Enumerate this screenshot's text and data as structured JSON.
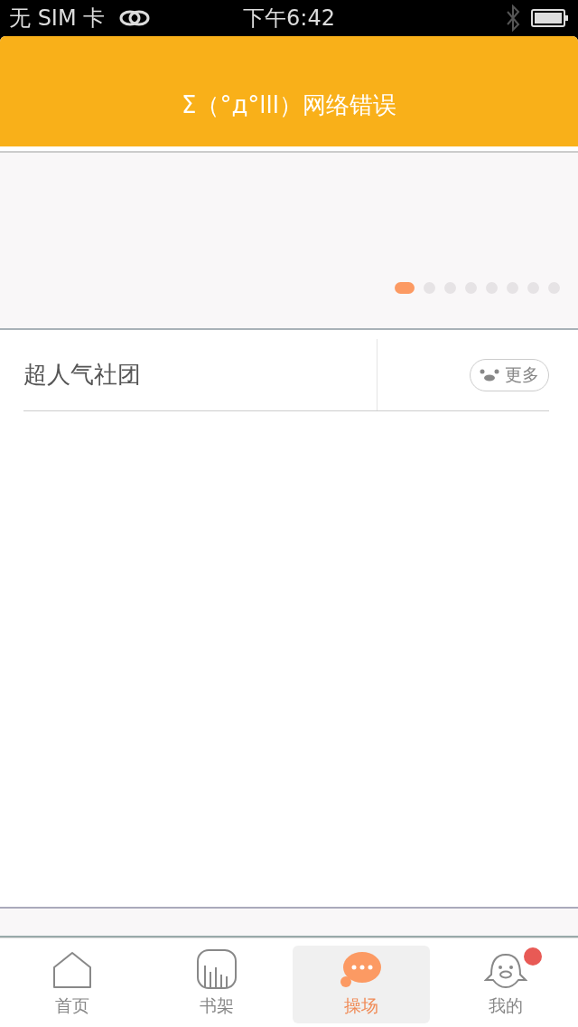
{
  "status_bar": {
    "carrier": "无 SIM 卡",
    "time": "下午6:42"
  },
  "header": {
    "message": "Σ（°д°lll）网络错误"
  },
  "banner": {
    "dots": [
      {
        "selected": true
      },
      {
        "selected": false
      },
      {
        "selected": false
      },
      {
        "selected": false
      },
      {
        "selected": false
      },
      {
        "selected": false
      },
      {
        "selected": false
      },
      {
        "selected": false
      }
    ]
  },
  "section": {
    "title": "超人气社团",
    "more": "更多"
  },
  "tabs": [
    {
      "kind": "home",
      "label": "首页",
      "selected": false,
      "badge": false
    },
    {
      "kind": "shelf",
      "label": "书架",
      "selected": false,
      "badge": false
    },
    {
      "kind": "chat",
      "label": "操场",
      "selected": true,
      "badge": false
    },
    {
      "kind": "me",
      "label": "我的",
      "selected": false,
      "badge": true
    }
  ]
}
